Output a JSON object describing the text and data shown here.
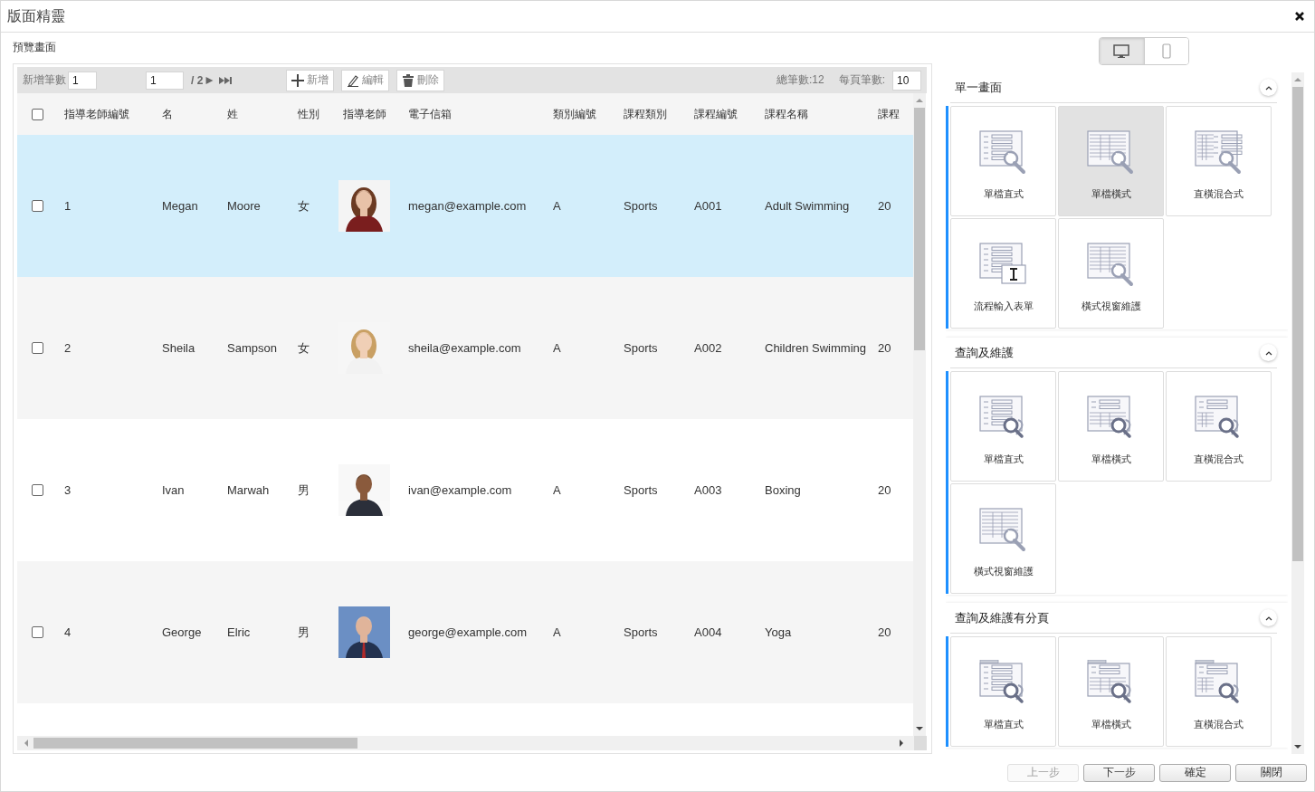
{
  "window": {
    "title": "版面精靈"
  },
  "preview_label": "預覽畫面",
  "toolbar": {
    "add_count_label": "新增筆數",
    "add_count_value": "1",
    "page_value": "1",
    "page_total": "/ 2",
    "buttons": [
      {
        "kind": "add",
        "label": "新增"
      },
      {
        "kind": "edit",
        "label": "編輯"
      },
      {
        "kind": "delete",
        "label": "刪除"
      }
    ],
    "total": "總筆數:12",
    "page_size_label": "每頁筆數:",
    "page_size_value": "10"
  },
  "table": {
    "header_checked": false,
    "columns": [
      "指導老師編號",
      "名",
      "姓",
      "性別",
      "指導老師",
      "電子信箱",
      "類別編號",
      "課程類別",
      "課程編號",
      "課程名稱",
      "課程"
    ],
    "rows": [
      {
        "selected": true,
        "checked": false,
        "cells": [
          "1",
          "Megan",
          "Moore",
          "女",
          "",
          "megan@example.com",
          "A",
          "Sports",
          "A001",
          "Adult Swimming",
          "20"
        ]
      },
      {
        "selected": false,
        "checked": false,
        "cells": [
          "2",
          "Sheila",
          "Sampson",
          "女",
          "",
          "sheila@example.com",
          "A",
          "Sports",
          "A002",
          "Children Swimming",
          "20"
        ]
      },
      {
        "selected": false,
        "checked": false,
        "cells": [
          "3",
          "Ivan",
          "Marwah",
          "男",
          "",
          "ivan@example.com",
          "A",
          "Sports",
          "A003",
          "Boxing",
          "20"
        ]
      },
      {
        "selected": false,
        "checked": false,
        "cells": [
          "4",
          "George",
          "Elric",
          "男",
          "",
          "george@example.com",
          "A",
          "Sports",
          "A004",
          "Yoga",
          "20"
        ]
      }
    ]
  },
  "device_toggle": [
    {
      "kind": "desktop",
      "selected": true
    },
    {
      "kind": "mobile",
      "selected": false
    }
  ],
  "sections": [
    {
      "title": "單一畫面",
      "tiles": [
        {
          "label": "單檔直式",
          "kind": "form",
          "selected": false
        },
        {
          "label": "單檔橫式",
          "kind": "grid",
          "selected": true
        },
        {
          "label": "直橫混合式",
          "kind": "mixed",
          "selected": false
        },
        {
          "label": "流程輸入表單",
          "kind": "input",
          "selected": false
        },
        {
          "label": "橫式視窗維護",
          "kind": "grid",
          "selected": false
        }
      ]
    },
    {
      "title": "查詢及維護",
      "tiles": [
        {
          "label": "單檔直式",
          "kind": "searchform",
          "selected": false
        },
        {
          "label": "單檔橫式",
          "kind": "searchgrid",
          "selected": false
        },
        {
          "label": "直橫混合式",
          "kind": "searchmixed",
          "selected": false
        },
        {
          "label": "橫式視窗維護",
          "kind": "grid",
          "selected": false
        }
      ]
    },
    {
      "title": "查詢及維護有分頁",
      "tiles": [
        {
          "label": "單檔直式",
          "kind": "pagedform",
          "selected": false
        },
        {
          "label": "單檔橫式",
          "kind": "pagedgrid",
          "selected": false
        },
        {
          "label": "直橫混合式",
          "kind": "pagedmixed",
          "selected": false
        }
      ]
    }
  ],
  "footer_buttons": [
    {
      "label": "上一步",
      "disabled": true
    },
    {
      "label": "下一步",
      "disabled": false
    },
    {
      "label": "確定",
      "disabled": false
    },
    {
      "label": "關閉",
      "disabled": false
    }
  ]
}
